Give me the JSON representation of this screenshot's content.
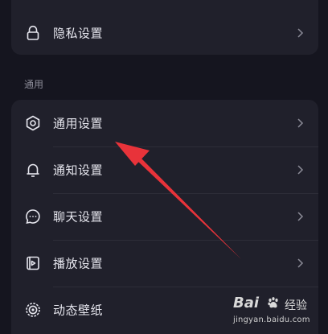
{
  "privacy_card": {
    "privacy_item": {
      "label": "隐私设置",
      "icon": "lock-icon"
    }
  },
  "general_section": {
    "title": "通用",
    "items": [
      {
        "label": "通用设置",
        "icon": "gear-icon"
      },
      {
        "label": "通知设置",
        "icon": "bell-icon"
      },
      {
        "label": "聊天设置",
        "icon": "chat-bubble-icon"
      },
      {
        "label": "播放设置",
        "icon": "play-device-icon"
      },
      {
        "label": "动态壁纸",
        "icon": "dynamic-wallpaper-icon"
      }
    ]
  },
  "annotation": {
    "color": "#e8333a"
  },
  "watermark": {
    "brand": "Bai",
    "brand_suffix": "经验",
    "url": "jingyan.baidu.com"
  },
  "colors": {
    "background": "#15151f",
    "card": "#20202b",
    "text": "#e6e6ee",
    "muted": "#8b8b97"
  }
}
